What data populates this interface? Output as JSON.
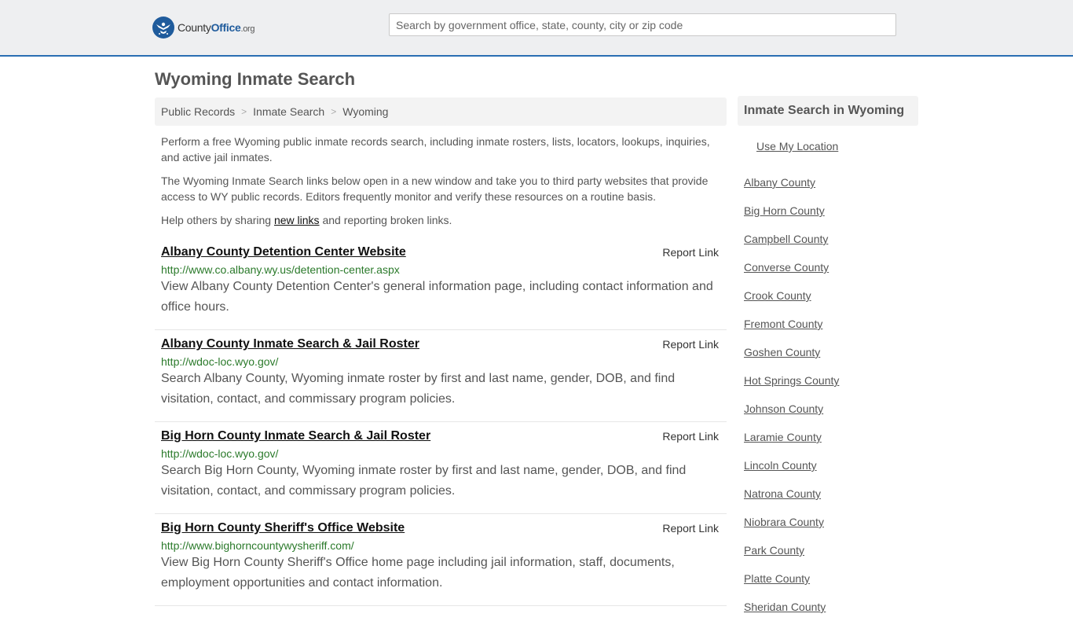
{
  "header": {
    "logo": {
      "county": "County",
      "office": "Office",
      "org": ".org"
    },
    "search_placeholder": "Search by government office, state, county, city or zip code",
    "accent_color": "#2a6eb3"
  },
  "page": {
    "title": "Wyoming Inmate Search"
  },
  "breadcrumb": {
    "items": [
      "Public Records",
      "Inmate Search",
      "Wyoming"
    ]
  },
  "intro": {
    "p1": "Perform a free Wyoming public inmate records search, including inmate rosters, lists, locators, lookups, inquiries, and active jail inmates.",
    "p2": "The Wyoming Inmate Search links below open in a new window and take you to third party websites that provide access to WY public records. Editors frequently monitor and verify these resources on a routine basis.",
    "p3_before": "Help others by sharing ",
    "p3_link": "new links",
    "p3_after": " and reporting broken links."
  },
  "results": [
    {
      "title": "Albany County Detention Center Website",
      "url": "http://www.co.albany.wy.us/detention-center.aspx",
      "description": "View Albany County Detention Center's general information page, including contact information and office hours.",
      "report_label": "Report Link"
    },
    {
      "title": "Albany County Inmate Search & Jail Roster",
      "url": "http://wdoc-loc.wyo.gov/",
      "description": "Search Albany County, Wyoming inmate roster by first and last name, gender, DOB, and find visitation, contact, and commissary program policies.",
      "report_label": "Report Link"
    },
    {
      "title": "Big Horn County Inmate Search & Jail Roster",
      "url": "http://wdoc-loc.wyo.gov/",
      "description": "Search Big Horn County, Wyoming inmate roster by first and last name, gender, DOB, and find visitation, contact, and commissary program policies.",
      "report_label": "Report Link"
    },
    {
      "title": "Big Horn County Sheriff's Office Website",
      "url": "http://www.bighorncountywysheriff.com/",
      "description": "View Big Horn County Sheriff's Office home page including jail information, staff, documents, employment opportunities and contact information.",
      "report_label": "Report Link"
    }
  ],
  "sidebar": {
    "heading": "Inmate Search in Wyoming",
    "use_location": "Use My Location",
    "counties": [
      "Albany County",
      "Big Horn County",
      "Campbell County",
      "Converse County",
      "Crook County",
      "Fremont County",
      "Goshen County",
      "Hot Springs County",
      "Johnson County",
      "Laramie County",
      "Lincoln County",
      "Natrona County",
      "Niobrara County",
      "Park County",
      "Platte County",
      "Sheridan County"
    ]
  }
}
